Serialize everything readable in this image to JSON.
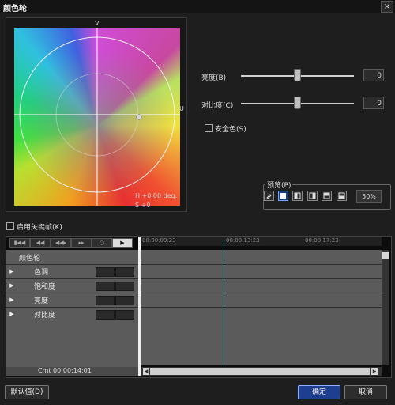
{
  "window": {
    "title": "颜色轮",
    "close_glyph": "×"
  },
  "wheel": {
    "top_label": "V",
    "right_label": "U",
    "hue_readout": "H  +0.00 deg.",
    "sat_readout": "S  +0"
  },
  "brightness": {
    "label": "亮度(B)",
    "value": "0",
    "level": 0
  },
  "contrast": {
    "label": "对比度(C)",
    "value": "0",
    "level": 0
  },
  "safe_color": {
    "label": "安全色(S)",
    "checked": false
  },
  "preview": {
    "label": "预览(P)",
    "percent": "50%",
    "selected_mode": "full-frame"
  },
  "keyframe": {
    "label": "启用关键帧(K)",
    "checked": false
  },
  "timeline": {
    "timecodes": [
      "00:00:09:23",
      "00:00:13:23",
      "00:00:17:23"
    ],
    "header_row": "颜色轮",
    "rows": [
      "色调",
      "饱和度",
      "亮度",
      "对比度"
    ],
    "current_time": "Cmt  00:00:14:01",
    "transport": [
      "▮◀◀",
      "◀◀",
      "◀◀▸",
      "▸▸",
      "○",
      "▶"
    ]
  },
  "buttons": {
    "default": "默认值(D)",
    "ok": "确定",
    "cancel": "取消"
  },
  "colors": {
    "accent": "#1e3e90",
    "background": "#1e1e1e",
    "track": "#5b5b5b"
  }
}
